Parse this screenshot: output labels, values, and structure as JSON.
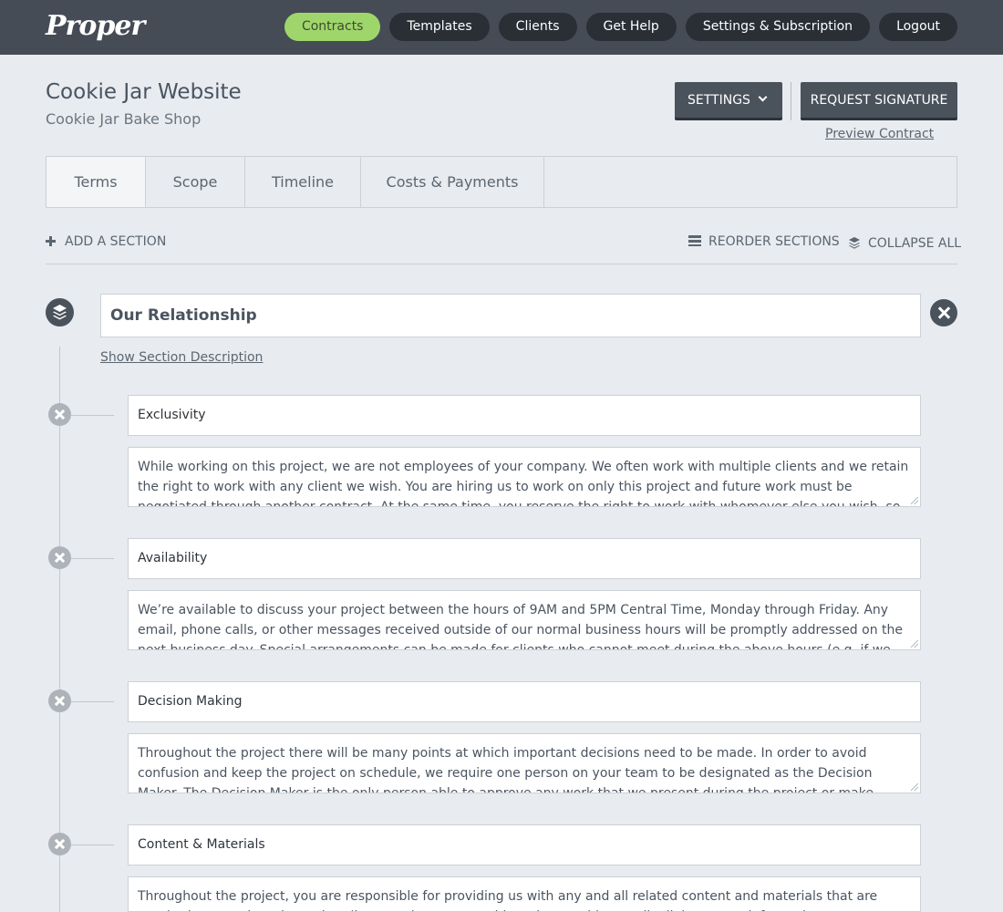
{
  "app": {
    "logo": "Proper"
  },
  "nav": [
    {
      "label": "Contracts",
      "active": true
    },
    {
      "label": "Templates"
    },
    {
      "label": "Clients"
    },
    {
      "label": "Get Help"
    },
    {
      "label": "Settings & Subscription"
    },
    {
      "label": "Logout"
    }
  ],
  "project": {
    "title": "Cookie Jar Website",
    "client": "Cookie Jar Bake Shop"
  },
  "actions": {
    "settings": "SETTINGS",
    "request_signature": "REQUEST SIGNATURE",
    "preview": "Preview Contract"
  },
  "tabs": [
    {
      "label": "Terms",
      "active": true
    },
    {
      "label": "Scope"
    },
    {
      "label": "Timeline"
    },
    {
      "label": "Costs & Payments"
    }
  ],
  "toolbar": {
    "add_section": "ADD A SECTION",
    "reorder": "REORDER SECTIONS",
    "collapse": "COLLAPSE ALL"
  },
  "section": {
    "title": "Our Relationship",
    "show_description": "Show Section Description",
    "clauses": [
      {
        "title": "Exclusivity",
        "body": "While working on this project, we are not employees of your company. We often work with multiple clients and we retain the right to work with any client we wish. You are hiring us to work on only this project and future work must be negotiated through another contract. At the same time, you reserve the right to work with whomever else you wish, so long as it"
      },
      {
        "title": "Availability",
        "body": "We’re available to discuss your project between the hours of 9AM and 5PM Central Time, Monday through Friday. Any email, phone calls, or other messages received outside of our normal business hours will be promptly addressed on the next business day. Special arrangements can be made for clients who cannot meet during the above hours (e.g. if we work in"
      },
      {
        "title": "Decision Making",
        "body": "Throughout the project there will be many points at which important decisions need to be made. In order to avoid confusion and keep the project on schedule, we require one person on your team to be designated as the Decision Maker. The Decision Maker is the only person able to approve any work that we present during the project or make requests for"
      },
      {
        "title": "Content & Materials",
        "body": "Throughout the project, you are responsible for providing us with any and all related content and materials that are required to complete the project (i.e. text, images, graphics, photos, video, audio, links, or any information"
      }
    ]
  }
}
